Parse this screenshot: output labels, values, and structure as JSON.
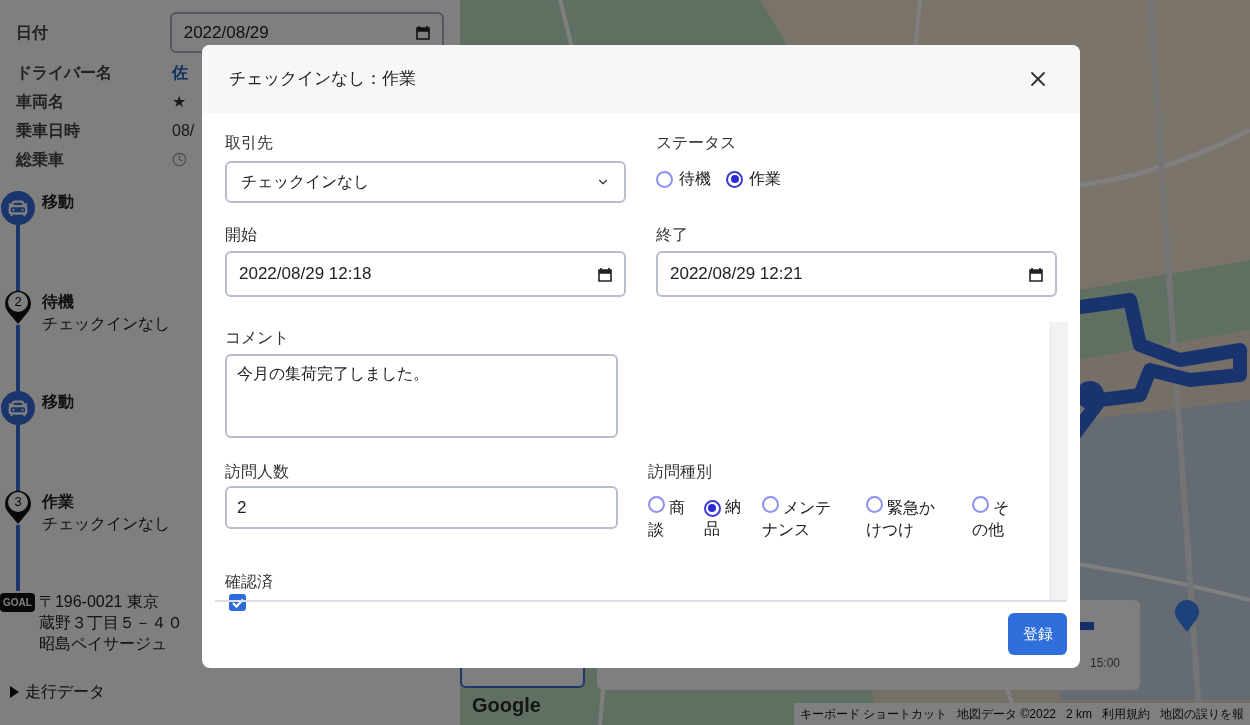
{
  "sidebar": {
    "fields": [
      {
        "label": "日付",
        "kind": "date",
        "value": "2022/08/29"
      },
      {
        "label": "ドライバー名",
        "kind": "link",
        "value": "佐"
      },
      {
        "label": "車両名",
        "kind": "text",
        "value": "★"
      },
      {
        "label": "乗車日時",
        "kind": "text",
        "value": "08/"
      },
      {
        "label": "総乗車",
        "kind": "duration"
      }
    ],
    "timeline": [
      {
        "kind": "move",
        "title": "移動"
      },
      {
        "kind": "stop",
        "number": "2",
        "title": "待機",
        "subtitle": "チェックインなし"
      },
      {
        "kind": "move",
        "title": "移動"
      },
      {
        "kind": "stop",
        "number": "3",
        "title": "作業",
        "subtitle": "チェックインなし"
      }
    ],
    "goal": {
      "badge": "GOAL",
      "address_lines": [
        "〒196-0021 東京",
        "蔵野３丁目５－４０",
        "昭島ペイサージュ"
      ]
    },
    "drive_data": {
      "label": "走行データ",
      "expanded": false
    }
  },
  "map": {
    "google_logo": "Google",
    "time_label": "15:00",
    "attribution": [
      "キーボード ショートカット",
      "地図データ ©2022",
      "2 km",
      "利用規約",
      "地図の誤りを報"
    ]
  },
  "dialog": {
    "title": "チェックインなし：作業",
    "client": {
      "label": "取引先",
      "value": "チェックインなし"
    },
    "status": {
      "label": "ステータス",
      "options": [
        {
          "label": "待機",
          "selected": false
        },
        {
          "label": "作業",
          "selected": true
        }
      ]
    },
    "start": {
      "label": "開始",
      "value": "2022/08/29 12:18"
    },
    "end": {
      "label": "終了",
      "value": "2022/08/29 12:21"
    },
    "comment": {
      "label": "コメント",
      "value": "今月の集荷完了しました。"
    },
    "visitors": {
      "label": "訪問人数",
      "value": "2"
    },
    "visit_type": {
      "label": "訪問種別",
      "options": [
        {
          "label": "商談",
          "selected": false
        },
        {
          "label": "納品",
          "selected": true
        },
        {
          "label": "メンテナンス",
          "selected": false
        },
        {
          "label": "緊急かけつけ",
          "selected": false
        },
        {
          "label": "その他",
          "selected": false
        }
      ]
    },
    "confirmed": {
      "label": "確認済",
      "checked": true
    },
    "submit": "登録"
  }
}
